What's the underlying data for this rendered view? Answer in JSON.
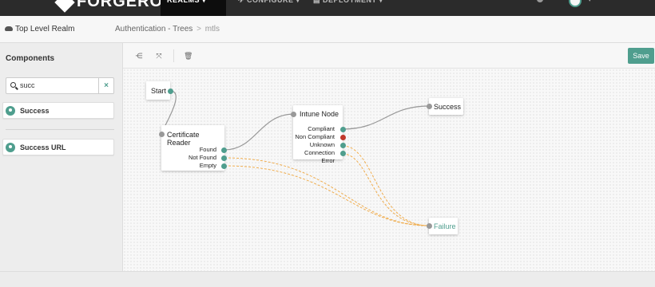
{
  "nav": {
    "brand": "FORGEROCK",
    "tabs": [
      {
        "label": "REALMS ▾",
        "active": true
      },
      {
        "label": "✈ CONFIGURE ▾",
        "active": false
      },
      {
        "label": "▤ DEPLOYMENT ▾",
        "active": false
      }
    ],
    "user_caret": "▾"
  },
  "header": {
    "realm": "Top Level Realm",
    "breadcrumb_parent": "Authentication - Trees",
    "breadcrumb_sep": ">",
    "breadcrumb_current": "mtls"
  },
  "sidebar": {
    "title": "Components",
    "search_value": "succ",
    "clear_icon": "×",
    "items": [
      {
        "label": "Success"
      },
      {
        "label": "Success URL"
      }
    ]
  },
  "toolbar": {
    "save_label": "Save",
    "icons": [
      "layout-icon",
      "fullscreen-icon",
      "delete-icon"
    ]
  },
  "tree": {
    "start": {
      "title": "Start"
    },
    "cert": {
      "title": "Certificate Reader",
      "outcomes": [
        "Found",
        "Not Found",
        "Empty"
      ]
    },
    "intune": {
      "title": "Intune Node",
      "outcomes": [
        "Compliant",
        "Non Compliant",
        "Unknown",
        "Connection Error"
      ]
    },
    "success": {
      "title": "Success"
    },
    "failure": {
      "title": "Failure"
    }
  },
  "colors": {
    "accent": "#4f9e8e",
    "danger": "#c0392b",
    "failure_wire": "#f0ad4e"
  }
}
